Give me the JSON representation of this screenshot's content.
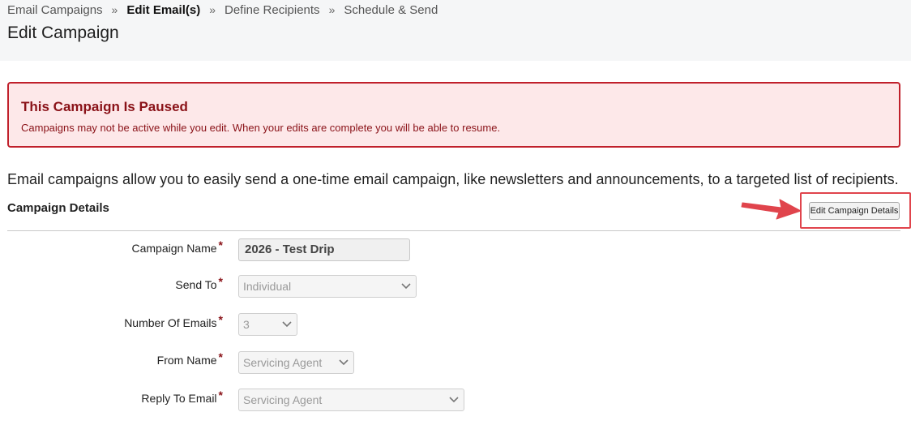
{
  "breadcrumb": {
    "items": [
      "Email Campaigns",
      "Edit Email(s)",
      "Define Recipients",
      "Schedule & Send"
    ],
    "separator": "»",
    "active_index": 1
  },
  "page": {
    "title": "Edit Campaign"
  },
  "alert": {
    "title": "This Campaign Is Paused",
    "message": "Campaigns may not be active while you edit. When your edits are complete you will be able to resume."
  },
  "intro": {
    "text": "Email campaigns allow you to easily send a one-time email campaign, like newsletters and announcements, to a targeted list of recipients."
  },
  "section": {
    "title": "Campaign Details",
    "edit_button": "Edit Campaign Details"
  },
  "form": {
    "required_marker": "*",
    "campaign_name": {
      "label": "Campaign Name",
      "value": "2026 - Test Drip"
    },
    "send_to": {
      "label": "Send To",
      "value": "Individual"
    },
    "number_of_emails": {
      "label": "Number Of Emails",
      "value": "3"
    },
    "from_name": {
      "label": "From Name",
      "value": "Servicing Agent"
    },
    "reply_to_email": {
      "label": "Reply To Email",
      "value": "Servicing Agent"
    }
  },
  "icons": {
    "annotation": "arrow-right-icon",
    "dropdown": "chevron-down-icon"
  },
  "colors": {
    "alert_border": "#c0202b",
    "alert_background": "#fde8e9",
    "alert_text": "#8a1218",
    "annotation_red": "#e0444c"
  }
}
